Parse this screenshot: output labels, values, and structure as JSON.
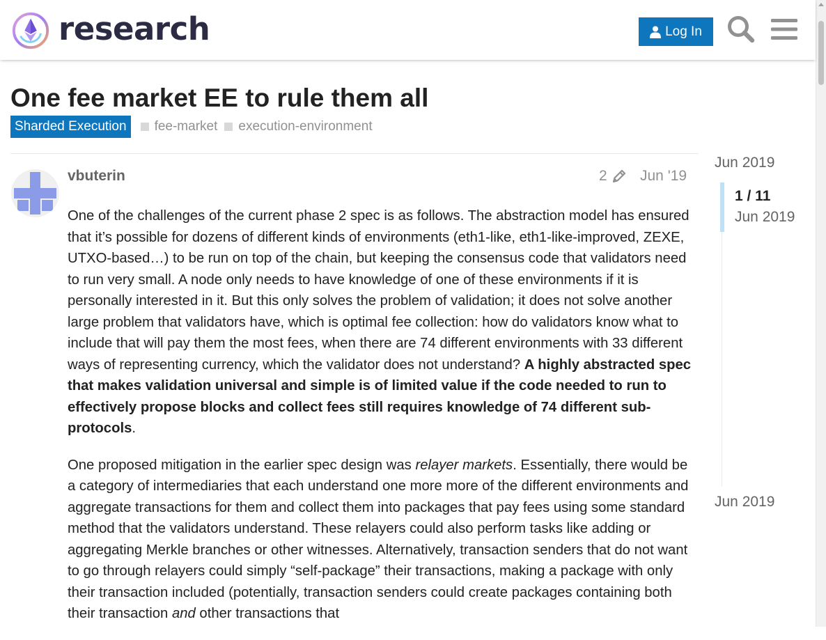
{
  "header": {
    "logo_text": "research",
    "login_label": "Log In",
    "icons": [
      "logo-icon",
      "user-icon",
      "search-icon",
      "hamburger-menu-icon"
    ]
  },
  "topic": {
    "title": "One fee market EE to rule them all",
    "category": "Sharded Execution",
    "tags": [
      "fee-market",
      "execution-environment"
    ]
  },
  "post": {
    "username": "vbuterin",
    "edit_count": "2",
    "date": "Jun '19",
    "paragraphs": [
      [
        {
          "text": "One of the challenges of the current phase 2 spec is as follows. The abstraction model has ensured that it’s possible for dozens of different kinds of environments (eth1-like, eth1-like-improved, ZEXE, UTXO-based…) to be run on top of the chain, but keeping the consensus code that validators need to run very small. A node only needs to have knowledge of one of these environments if it is personally interested in it. But this only solves the problem of validation; it does not solve another large problem that validators have, which is optimal fee collection: how do validators know what to include that will pay them the most fees, when there are 74 different environments with 33 different ways of representing currency, which the validator does not understand? ",
          "style": "normal"
        },
        {
          "text": "A highly abstracted spec that makes validation universal and simple is of limited value if the code needed to run to effectively propose blocks and collect fees still requires knowledge of 74 different sub-protocols",
          "style": "bold"
        },
        {
          "text": ".",
          "style": "normal"
        }
      ],
      [
        {
          "text": "One proposed mitigation in the earlier spec design was ",
          "style": "normal"
        },
        {
          "text": "relayer markets",
          "style": "italic"
        },
        {
          "text": ". Essentially, there would be a category of intermediaries that each understand one more more of the different environments and aggregate transactions for them and collect them into packages that pay fees using some standard method that the validators understand. These relayers could also perform tasks like adding or aggregating Merkle branches or other witnesses. Alternatively, transaction senders that do not want to go through relayers could simply “self-package” their transactions, making a package with only their transaction included (potentially, transaction senders could create packages containing both their transaction ",
          "style": "normal"
        },
        {
          "text": "and",
          "style": "italic"
        },
        {
          "text": " other transactions that",
          "style": "normal"
        }
      ]
    ]
  },
  "timeline": {
    "top_date": "Jun 2019",
    "position": "1 / 11",
    "position_date": "Jun 2019",
    "bottom_date": "Jun 2019"
  },
  "colors": {
    "accent": "#0e76bd",
    "title": "#222222",
    "muted": "#919191",
    "timeline_handle": "#bfe1f5",
    "avatar_fg": "#8c9be8"
  }
}
